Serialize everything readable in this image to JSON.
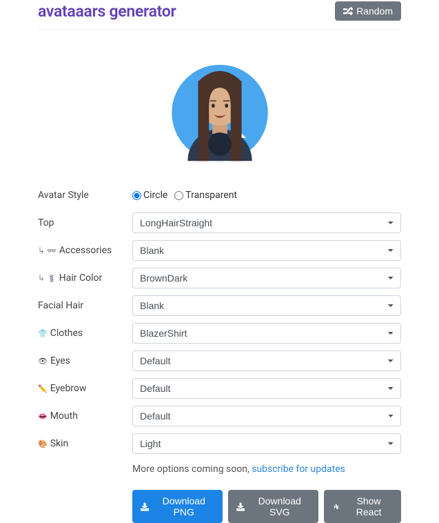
{
  "header": {
    "title": "avataaars generator",
    "random_button": "Random"
  },
  "avatar_style": {
    "label": "Avatar Style",
    "option_circle": "Circle",
    "option_transparent": "Transparent",
    "selected": "Circle"
  },
  "fields": {
    "top": {
      "label": "Top",
      "value": "LongHairStraight",
      "prefix": ""
    },
    "accessories": {
      "label": "Accessories",
      "value": "Blank",
      "prefix": "↳ 👓 "
    },
    "hair_color": {
      "label": "Hair Color",
      "value": "BrownDark",
      "prefix": "↳ 🎨 "
    },
    "facial_hair": {
      "label": "Facial Hair",
      "value": "Blank",
      "prefix": ""
    },
    "clothes": {
      "label": "Clothes",
      "value": "BlazerShirt",
      "prefix": "👕 "
    },
    "eyes": {
      "label": "Eyes",
      "value": "Default",
      "prefix": "👁 "
    },
    "eyebrow": {
      "label": "Eyebrow",
      "value": "Default",
      "prefix": "✏️ "
    },
    "mouth": {
      "label": "Mouth",
      "value": "Default",
      "prefix": "👄 "
    },
    "skin": {
      "label": "Skin",
      "value": "Light",
      "prefix": "🎨 "
    }
  },
  "footer": {
    "more_options_text": "More options coming soon, ",
    "subscribe_link": "subscribe for updates",
    "download_png": "Download PNG",
    "download_svg": "Download SVG",
    "show_react": "Show React"
  }
}
